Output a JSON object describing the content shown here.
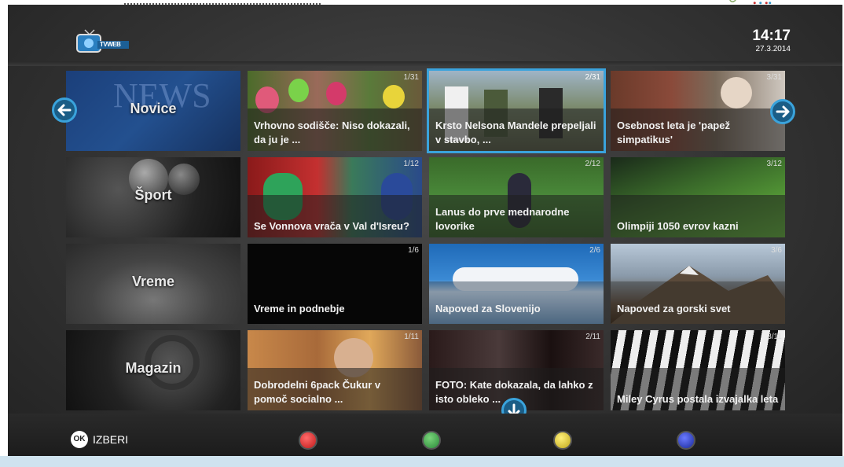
{
  "app": {
    "logo_text": "TVWEB"
  },
  "clock": {
    "time": "14:17",
    "date": "27.3.2014"
  },
  "rows": [
    {
      "category": "Novice",
      "items": [
        {
          "counter": "1/31",
          "title": "Vrhovno sodišče: Niso dokazali, da ju je ..."
        },
        {
          "counter": "2/31",
          "title": "Krsto Nelsona Mandele prepeljali v stavbo, ..."
        },
        {
          "counter": "3/31",
          "title": "Osebnost leta je 'papež simpatikus'"
        }
      ]
    },
    {
      "category": "Šport",
      "items": [
        {
          "counter": "1/12",
          "title": "Se Vonnova vrača v Val d'Isreu?"
        },
        {
          "counter": "2/12",
          "title": "Lanus do prve mednarodne lovorike"
        },
        {
          "counter": "3/12",
          "title": "Olimpiji 1050 evrov kazni"
        }
      ]
    },
    {
      "category": "Vreme",
      "items": [
        {
          "counter": "1/6",
          "title": "Vreme in podnebje"
        },
        {
          "counter": "2/6",
          "title": "Napoved za Slovenijo"
        },
        {
          "counter": "3/6",
          "title": "Napoved za gorski svet"
        }
      ]
    },
    {
      "category": "Magazin",
      "items": [
        {
          "counter": "1/11",
          "title": "Dobrodelni 6pack Čukur v pomoč socialno ..."
        },
        {
          "counter": "2/11",
          "title": "FOTO: Kate dokazala, da lahko z isto obleko ..."
        },
        {
          "counter": "3/11",
          "title": "Miley Cyrus postala izvajalka leta"
        }
      ]
    }
  ],
  "footer": {
    "ok_key": "OK",
    "ok_label": "IZBERI"
  },
  "colors": {
    "accent": "#3aa3dc",
    "red": "#d0202a",
    "green": "#2f9a3c",
    "yellow": "#d8c21c",
    "blue": "#2c3fb0"
  }
}
